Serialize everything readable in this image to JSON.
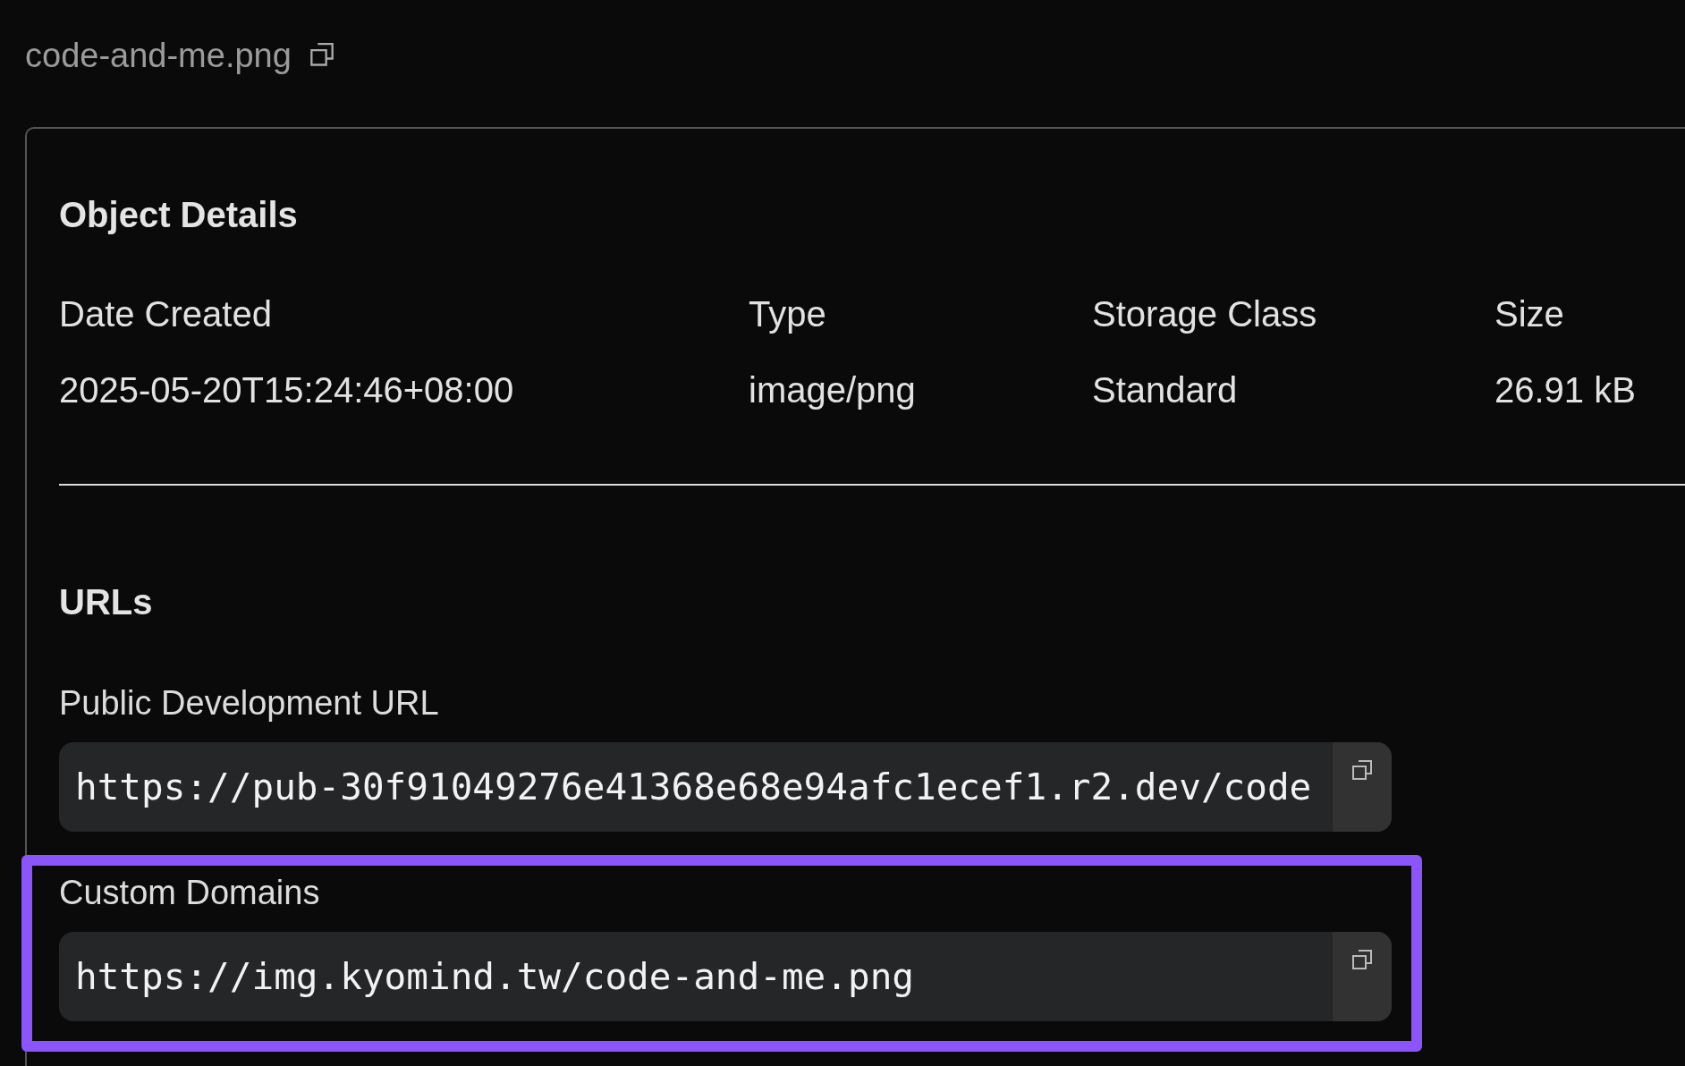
{
  "file": {
    "name": "code-and-me.png"
  },
  "details": {
    "title": "Object Details",
    "columns": [
      {
        "label": "Date Created",
        "value": "2025-05-20T15:24:46+08:00"
      },
      {
        "label": "Type",
        "value": "image/png"
      },
      {
        "label": "Storage Class",
        "value": "Standard"
      },
      {
        "label": "Size",
        "value": "26.91 kB"
      }
    ]
  },
  "urls": {
    "title": "URLs",
    "sections": [
      {
        "label": "Public Development URL",
        "value": "https://pub-30f91049276e41368e68e94afc1ecef1.r2.dev/code",
        "highlighted": false
      },
      {
        "label": "Custom Domains",
        "value": "https://img.kyomind.tw/code-and-me.png",
        "highlighted": true
      }
    ]
  }
}
